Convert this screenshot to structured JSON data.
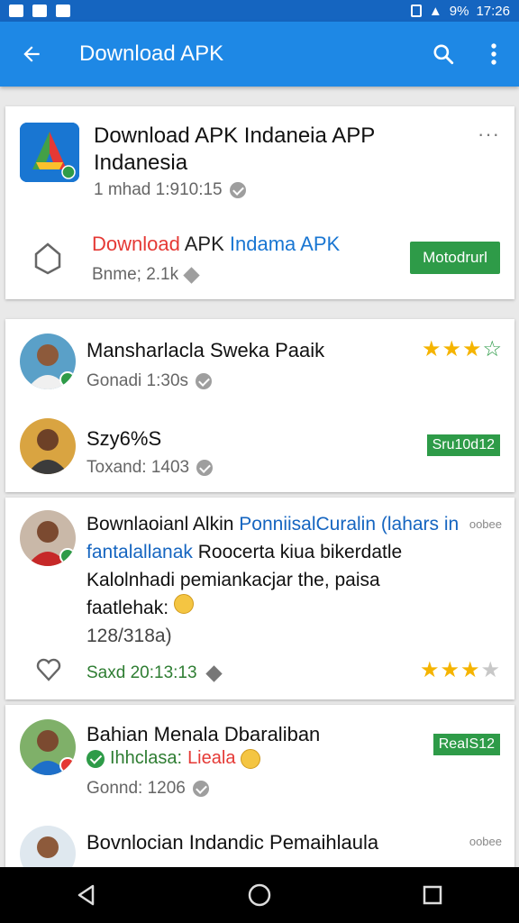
{
  "status": {
    "battery": "9%",
    "time": "17:26"
  },
  "appbar": {
    "title": "Download APK"
  },
  "app_card": {
    "title": "Download APK Indaneia APP Indanesia",
    "meta": "1 mhad 1:910:15",
    "line2_red": "Download",
    "line2_dark": " APK ",
    "line2_blue": "Indama APK",
    "meta2": "Bnme; 2.1k",
    "button_label": "Motodrurl",
    "more": "···"
  },
  "reviews": [
    {
      "name": "Mansharlacla Sweka Paaik",
      "meta": "Gonadi 1:30s",
      "rating": 3
    },
    {
      "name": "Szy6%S",
      "meta": "Toxand: 1403",
      "tag": "Sru10d12"
    }
  ],
  "post": {
    "text_dark": "Bownlaoianl Alkin ",
    "text_blue": "PonniisalCuralin (lahars in fantalallanak",
    "text_rest": " Roocerta kiua bikerdatle Kalolnhadi pemiankacjar the, paisa faatlehak:",
    "count": "128/318a)",
    "foot": "Saxd 20:13:13",
    "rating": 3,
    "more": "oobee"
  },
  "last": {
    "name": "Bahian Menala Dbaraliban",
    "line2_green": "Ihhclasa: ",
    "line2_red": "Lieala",
    "meta": "Gonnd: 1206",
    "tag": "ReaIS12",
    "name2": "Bovnlocian Indandic Pemaihlaula",
    "more": "oobee"
  },
  "colors": {
    "primary": "#1e88e5",
    "status_bar": "#1565c0",
    "accent_green": "#2e9b48",
    "star": "#f5b400"
  }
}
